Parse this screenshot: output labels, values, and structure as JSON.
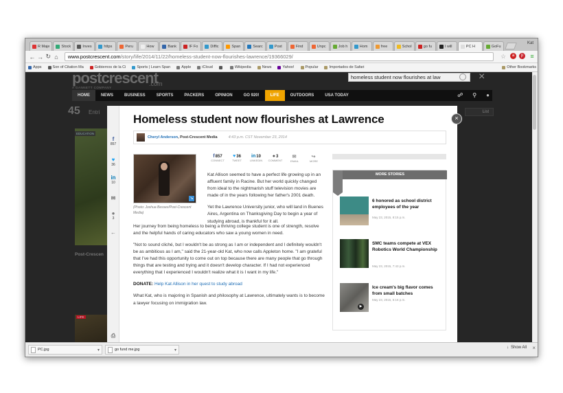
{
  "browser": {
    "user_name": "Kat",
    "tabs": [
      {
        "label": "R Maje",
        "color": "#d33"
      },
      {
        "label": "Stock",
        "color": "#3a7"
      },
      {
        "label": "Inves",
        "color": "#555"
      },
      {
        "label": "https",
        "color": "#39c"
      },
      {
        "label": "Peru",
        "color": "#e63"
      },
      {
        "label": "How",
        "color": "#eee"
      },
      {
        "label": "Bank",
        "color": "#36a"
      },
      {
        "label": "IF Fo",
        "color": "#c22"
      },
      {
        "label": "Diffic",
        "color": "#39c"
      },
      {
        "label": "Span",
        "color": "#f90"
      },
      {
        "label": "Searc",
        "color": "#27b"
      },
      {
        "label": "Post",
        "color": "#39c"
      },
      {
        "label": "Find",
        "color": "#e63"
      },
      {
        "label": "Unpc",
        "color": "#e63"
      },
      {
        "label": "Job h",
        "color": "#6a3"
      },
      {
        "label": "Hom",
        "color": "#39c"
      },
      {
        "label": "free",
        "color": "#e93"
      },
      {
        "label": "Schol",
        "color": "#eb2"
      },
      {
        "label": "go fu",
        "color": "#c22"
      },
      {
        "label": "I will",
        "color": "#222"
      },
      {
        "label": "PC H",
        "color": "#ddd",
        "active": true
      },
      {
        "label": "GoFu",
        "color": "#6a3"
      }
    ],
    "url_host": "www.postcrescent.com",
    "url_path": "/story/life/2014/11/22/homeless-student-now-flourishes-lawrence/19366029/",
    "bookmarks": [
      {
        "label": "Apps",
        "color": "#36a"
      },
      {
        "label": "Son of Citation Ma",
        "color": "#555"
      },
      {
        "label": "Gobiernos de la Ci",
        "color": "#c22"
      },
      {
        "label": "Sports | Learn Span",
        "color": "#39c"
      },
      {
        "label": "Apple",
        "color": "#777"
      },
      {
        "label": "iCloud",
        "color": "#777"
      },
      {
        "label": "",
        "color": "#555"
      },
      {
        "label": "Wikipedia",
        "color": "#777"
      },
      {
        "label": "News",
        "color": "#a96"
      },
      {
        "label": "Yahoo!",
        "color": "#609"
      },
      {
        "label": "Popular",
        "color": "#a96"
      },
      {
        "label": "Importados de Safari",
        "color": "#a96"
      }
    ],
    "other_bookmarks": "Other Bookmarks"
  },
  "background_page": {
    "logo": "postcrescent",
    "logo_suffix": ".com",
    "tagline": "A GANNETT COMPANY",
    "search_value": "homeless student now flourishes at law",
    "nav": [
      "HOME",
      "NEWS",
      "BUSINESS",
      "SPORTS",
      "PACKERS",
      "OPINION",
      "GO 920!",
      "LIFE",
      "OUTDOORS",
      "USA TODAY"
    ],
    "count": "45",
    "count_label": "Entri",
    "section_tag": "EDUCATION",
    "side_text": "Post-Crescen",
    "list_button": "List",
    "tag2": "LIFE"
  },
  "article": {
    "title": "Homeless student now flourishes at Lawrence",
    "author": "Cheryl Anderson",
    "org": ", Post-Crescent Media",
    "timestamp": "4:43 p.m. CST November 23, 2014",
    "share": [
      {
        "icon": "f",
        "count": "857",
        "label": "CONNECT",
        "color": "#3b5998"
      },
      {
        "icon": "t",
        "count": "36",
        "label": "TWEET",
        "color": "#1da1f2"
      },
      {
        "icon": "in",
        "count": "10",
        "label": "LINKEDIN",
        "color": "#0077b5"
      },
      {
        "icon": "c",
        "count": "3",
        "label": "COMMENT",
        "color": "#555"
      },
      {
        "icon": "e",
        "count": "",
        "label": "EMAIL",
        "color": "#888"
      },
      {
        "icon": "m",
        "count": "",
        "label": "MORE",
        "color": "#888"
      }
    ],
    "rail": [
      {
        "icon": "f",
        "count": "857",
        "color": "#3b5998"
      },
      {
        "icon": "t",
        "count": "36",
        "color": "#1da1f2"
      },
      {
        "icon": "in",
        "count": "10",
        "color": "#0077b5"
      },
      {
        "icon": "e",
        "count": "",
        "color": "#777"
      },
      {
        "icon": "c",
        "count": "3",
        "color": "#777"
      },
      {
        "icon": "m",
        "count": "",
        "color": "#777"
      },
      {
        "icon": "p",
        "count": "",
        "color": "#777"
      }
    ],
    "photo_caption": "(Photo: Joshua Bessex/Post-Crescent Media)",
    "paragraphs": [
      "Kat Allison seemed to have a perfect life growing up in an affluent family in Racine. But her world quickly changed from ideal to the nightmarish stuff television movies are made of in the years following her father's 2001 death.",
      "Yet the Lawrence University junior, who will land in Buenes Aires, Argentina on Thanksgiving Day to begin a year of studying abroad, is thankful for it all.",
      "Her journey from being homeless to being a thriving college student is one of strength, resolve and the helpful hands of caring educators who saw a young women in need.",
      "\"Not to sound cliché, but I wouldn't be as strong as I am or independent and I definitely wouldn't be as ambitious as I am,\" said the 21-year-old Kat, who now calls Appleton home. \"I am grateful that I've had this opportunity to come out on top because there are many people that go through things that are testing and trying and it doesn't develop character. If I had not experienced everything that I experienced I wouldn't realize what it is I want in my life.\""
    ],
    "donate_label": "DONATE:",
    "donate_link": "Help Kat Allison in her quest to study abroad",
    "last_paragraph": "What Kat, who is majoring in Spanish and philosophy at Lawrence, ultimately wants is to become a lawyer focusing on immigration law."
  },
  "more_stories": {
    "header": "MORE STORIES",
    "items": [
      {
        "title": "6 honored as school district employees of the year",
        "date": "May 23, 2015, 8:15 p.m."
      },
      {
        "title": "SMC teams compete at VEX Robotics World Championship",
        "date": "May 23, 2015, 7:43 p.m."
      },
      {
        "title": "Ice cream's big flavor comes from small batches",
        "date": "May 23, 2015, 5:16 p.m."
      }
    ]
  },
  "downloads": {
    "items": [
      "PC.jpg",
      "go fund me.jpg"
    ],
    "show_all": "Show All"
  }
}
